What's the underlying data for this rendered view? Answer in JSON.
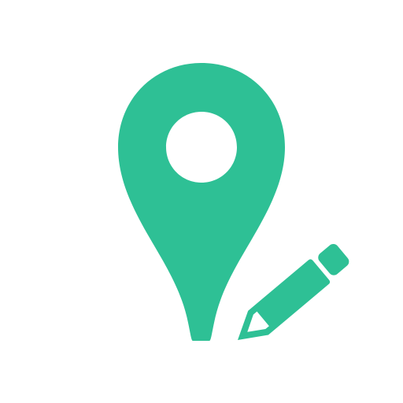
{
  "icon": {
    "name": "edit-location-icon",
    "parts": [
      "map-pin-icon",
      "pencil-icon"
    ],
    "colors": {
      "primary": "#2EC095",
      "background": "#FFFFFF"
    }
  }
}
